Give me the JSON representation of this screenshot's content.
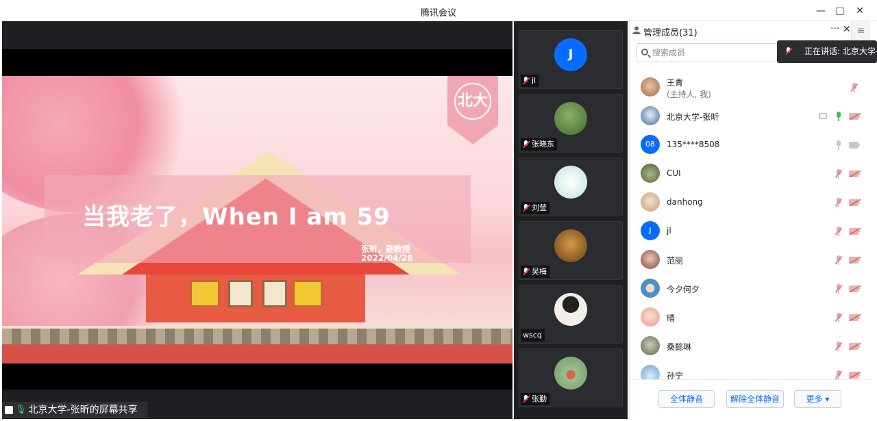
{
  "window": {
    "title": "腾讯会议",
    "controls": {
      "minimize": "—",
      "maximize": "□",
      "close": "✕"
    }
  },
  "share": {
    "slide_title": "当我老了，When I am 59",
    "slide_author": "张昕，副教授",
    "slide_date": "2022/04/28",
    "emblem_text": "北大",
    "bar_label": "北京大学-张昕的屏幕共享"
  },
  "videos": [
    {
      "name": "jl",
      "avatar_letter": "J",
      "avatar_color": "#0a6cff"
    },
    {
      "name": "张晓东",
      "avatar_color": "#5f8a3c"
    },
    {
      "name": "刘莹",
      "avatar_color": "#d8ece9"
    },
    {
      "name": "吴梅",
      "avatar_color": "#9a6428"
    },
    {
      "name": "wscq",
      "avatar_color": "#e8e4df"
    },
    {
      "name": "张勤",
      "avatar_color": "#7fa07a"
    }
  ],
  "panel": {
    "title": "管理成员(31)",
    "more": "···",
    "close": "✕",
    "side_button": "≡",
    "search_placeholder": "搜索成员",
    "speaking_toast": "正在讲话: 北京大学-张",
    "members": [
      {
        "name": "王青",
        "sub": "(主持人, 我)",
        "avatar_color": "#c98f6d"
      },
      {
        "name": "北京大学-张昕",
        "avatar_color": "#3a6aa0"
      },
      {
        "name": "135****8508",
        "avatar_letter": "08",
        "avatar_color": "#0a6cff"
      },
      {
        "name": "CUI",
        "avatar_color": "#6a7d4a"
      },
      {
        "name": "danhong",
        "avatar_color": "#e0c6a8"
      },
      {
        "name": "jl",
        "avatar_letter": "J",
        "avatar_color": "#0a6cff"
      },
      {
        "name": "范丽",
        "avatar_color": "#b77b6a"
      },
      {
        "name": "今夕何夕",
        "avatar_color": "#4b90c8"
      },
      {
        "name": "晴",
        "avatar_color": "#f0b8a8"
      },
      {
        "name": "桑懿琳",
        "avatar_color": "#8a8f7a"
      },
      {
        "name": "孙宁",
        "avatar_color": "#6aa3d8"
      }
    ],
    "footer": {
      "mute_all": "全体静音",
      "unmute_all": "解除全体静音",
      "more": "更多 ▾"
    }
  }
}
